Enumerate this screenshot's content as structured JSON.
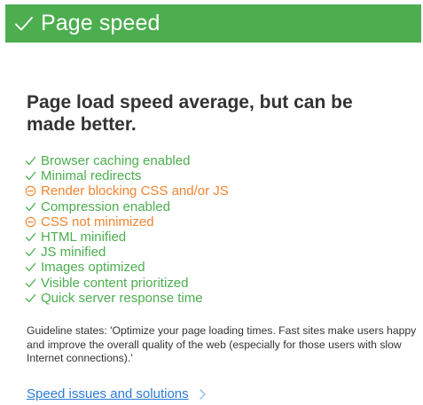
{
  "header": {
    "title": "Page speed",
    "icon": "check-icon",
    "background": "#4cae4f"
  },
  "summary": "Page load speed average, but can be made better.",
  "checks": [
    {
      "label": "Browser caching enabled",
      "status": "pass"
    },
    {
      "label": "Minimal redirects",
      "status": "pass"
    },
    {
      "label": "Render blocking CSS and/or JS",
      "status": "fail"
    },
    {
      "label": "Compression enabled",
      "status": "pass"
    },
    {
      "label": "CSS not minimized",
      "status": "fail"
    },
    {
      "label": "HTML minified",
      "status": "pass"
    },
    {
      "label": "JS minified",
      "status": "pass"
    },
    {
      "label": "Images optimized",
      "status": "pass"
    },
    {
      "label": "Visible content prioritized",
      "status": "pass"
    },
    {
      "label": "Quick server response time",
      "status": "pass"
    }
  ],
  "guideline": "Guideline states: 'Optimize your page loading times. Fast sites make users happy and improve the overall quality of the web (especially for those users with slow Internet connections).'",
  "link": {
    "label": "Speed issues and solutions",
    "icon": "chevron-right-icon"
  },
  "colors": {
    "pass": "#4cae4f",
    "fail": "#f4842f",
    "link": "#2a7bd8"
  }
}
